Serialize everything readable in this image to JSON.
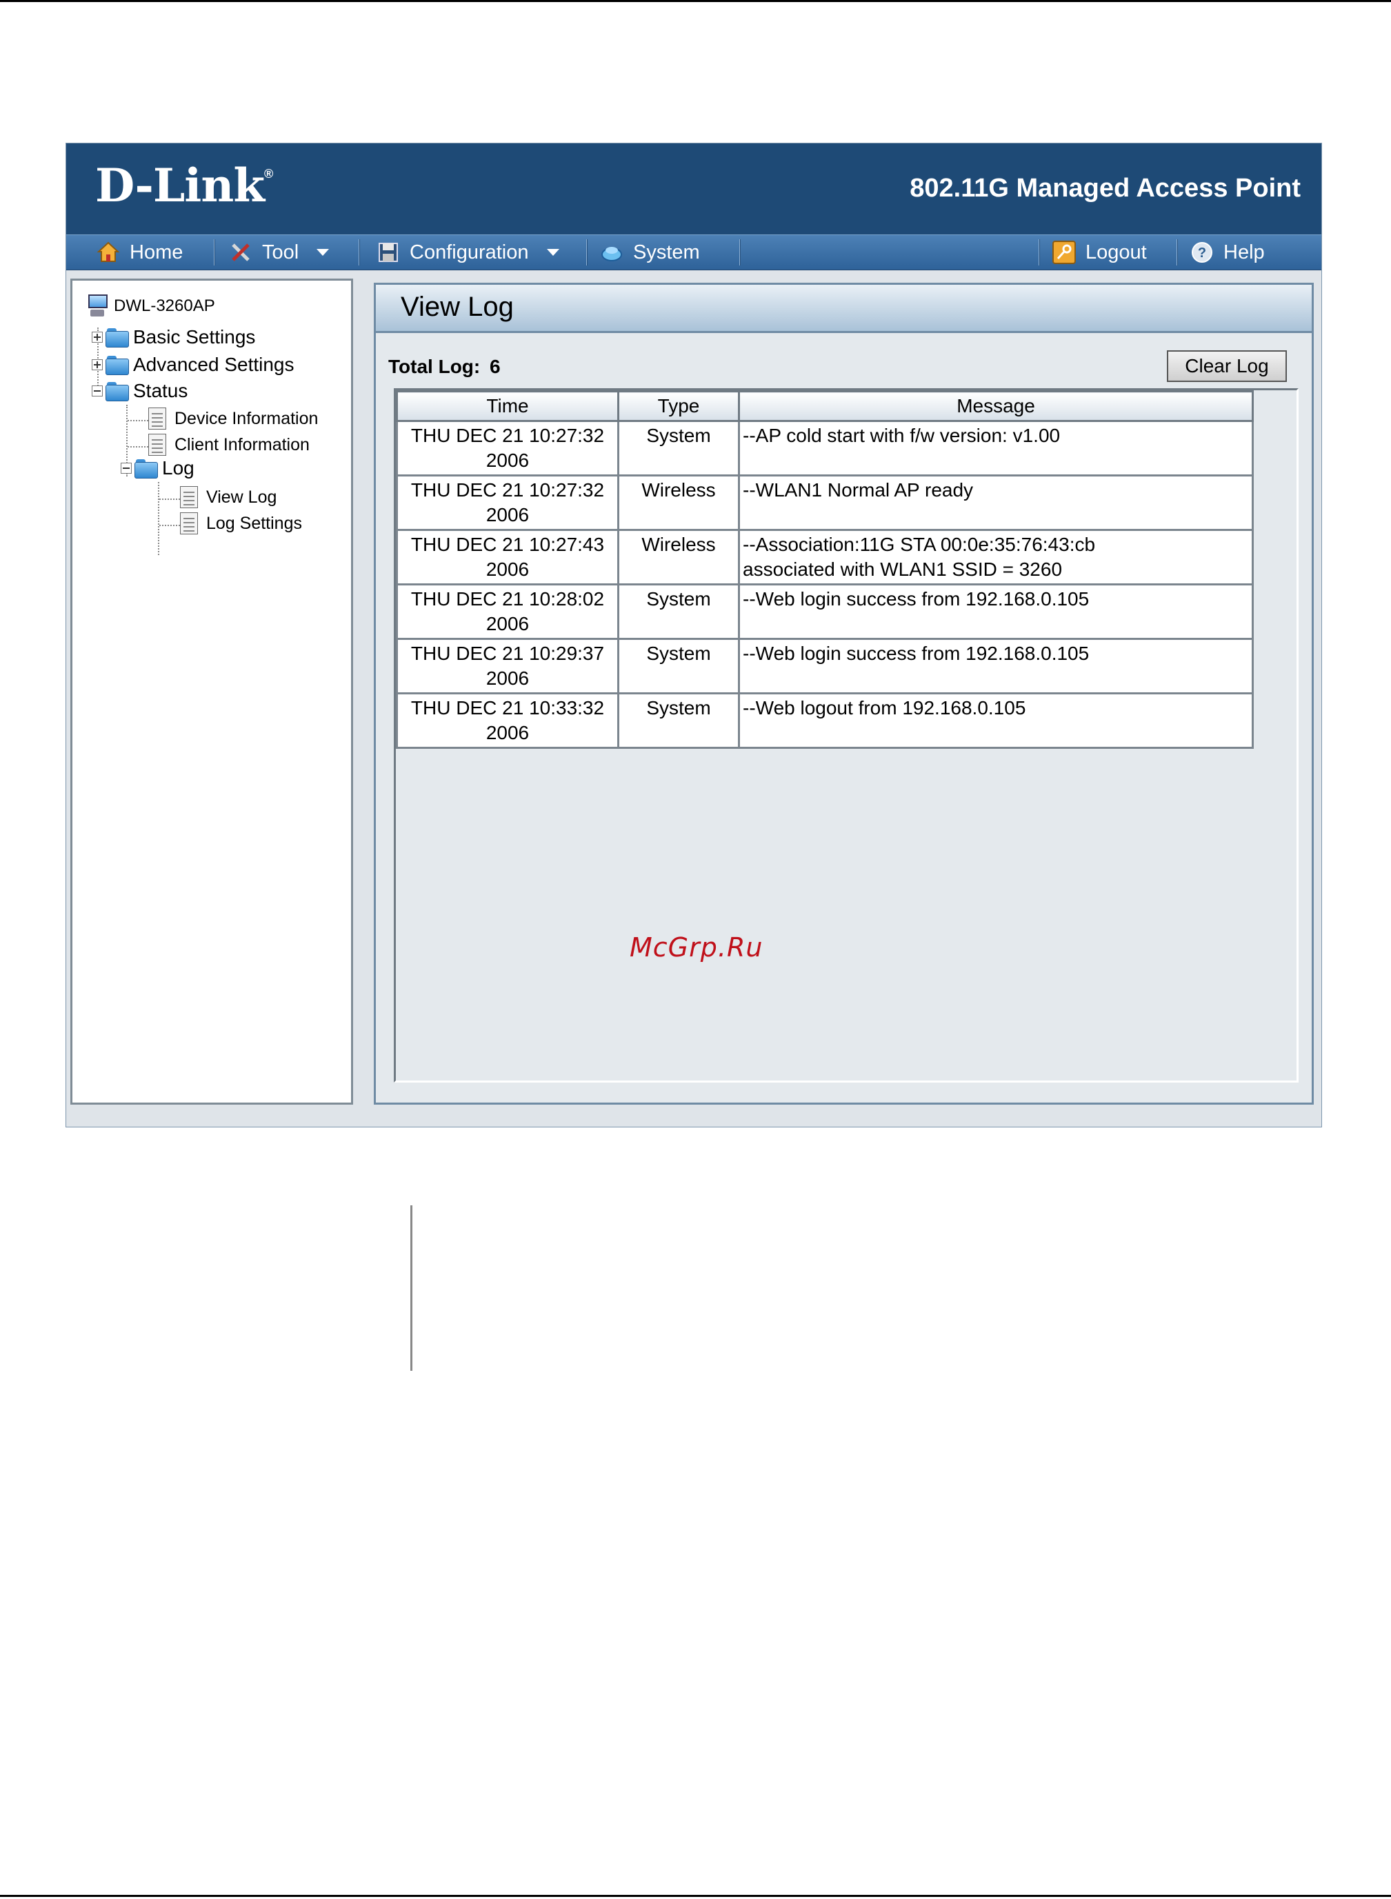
{
  "brand": {
    "logo": "D-Link",
    "logo_mark": "®",
    "product": "802.11G Managed Access Point"
  },
  "menu": {
    "home": "Home",
    "tool": "Tool",
    "configuration": "Configuration",
    "system": "System",
    "logout": "Logout",
    "help": "Help"
  },
  "tree": {
    "root": "DWL-3260AP",
    "basic": "Basic Settings",
    "advanced": "Advanced Settings",
    "status": "Status",
    "device_info": "Device Information",
    "client_info": "Client Information",
    "log": "Log",
    "view_log": "View Log",
    "log_settings": "Log Settings"
  },
  "page": {
    "title": "View Log",
    "total_label": "Total Log:",
    "total_value": "6",
    "clear_button": "Clear Log"
  },
  "log_table": {
    "headers": [
      "Time",
      "Type",
      "Message"
    ],
    "rows": [
      {
        "time_line1": "THU DEC 21 10:27:32",
        "time_line2": "2006",
        "type": "System",
        "msg_line1": "--AP cold start with f/w version: v1.00",
        "msg_line2": ""
      },
      {
        "time_line1": "THU DEC 21 10:27:32",
        "time_line2": "2006",
        "type": "Wireless",
        "msg_line1": "--WLAN1 Normal AP ready",
        "msg_line2": ""
      },
      {
        "time_line1": "THU DEC 21 10:27:43",
        "time_line2": "2006",
        "type": "Wireless",
        "msg_line1": "--Association:11G STA 00:0e:35:76:43:cb",
        "msg_line2": "associated with WLAN1 SSID = 3260"
      },
      {
        "time_line1": "THU DEC 21 10:28:02",
        "time_line2": "2006",
        "type": "System",
        "msg_line1": "--Web login success from 192.168.0.105",
        "msg_line2": ""
      },
      {
        "time_line1": "THU DEC 21 10:29:37",
        "time_line2": "2006",
        "type": "System",
        "msg_line1": "--Web login success from 192.168.0.105",
        "msg_line2": ""
      },
      {
        "time_line1": "THU DEC 21 10:33:32",
        "time_line2": "2006",
        "type": "System",
        "msg_line1": "--Web logout from 192.168.0.105",
        "msg_line2": ""
      }
    ]
  },
  "watermark": "McGrp.Ru",
  "colors": {
    "header_bg": "#1e4a76",
    "menubar": "#3a6fa6",
    "panel_bg": "#e4e9ed",
    "watermark": "#c0101a"
  }
}
